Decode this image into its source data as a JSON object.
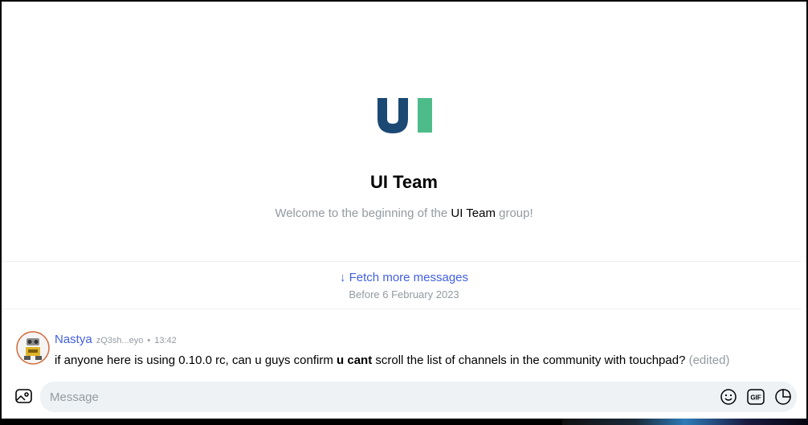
{
  "group": {
    "name": "UI Team",
    "logo_text": "UI",
    "logo_colors": {
      "u": "#1c4974",
      "i": "#4ebc8a"
    }
  },
  "welcome": {
    "prefix": "Welcome to the beginning of the",
    "group_name": "UI Team",
    "suffix": "group!"
  },
  "history": {
    "fetch_label": "↓ Fetch more messages",
    "before_label": "Before 6 February 2023"
  },
  "message": {
    "author": "Nastya",
    "pubkey": "zQ3sh...eyo",
    "separator": "•",
    "time": "13:42",
    "text_before": "if anyone here is using 0.10.0 rc, can u guys confirm",
    "text_bold": "u cant",
    "text_after": "scroll the list of channels in the community with touchpad?",
    "edited": "(edited)"
  },
  "composer": {
    "placeholder": "Message",
    "image_icon": "image-icon",
    "emoji_icon": "emoji-icon",
    "gif_label": "GIF",
    "sticker_icon": "sticker-icon"
  },
  "colors": {
    "accent": "#4360df",
    "muted": "#939ba1",
    "input_bg": "#eef2f5"
  }
}
